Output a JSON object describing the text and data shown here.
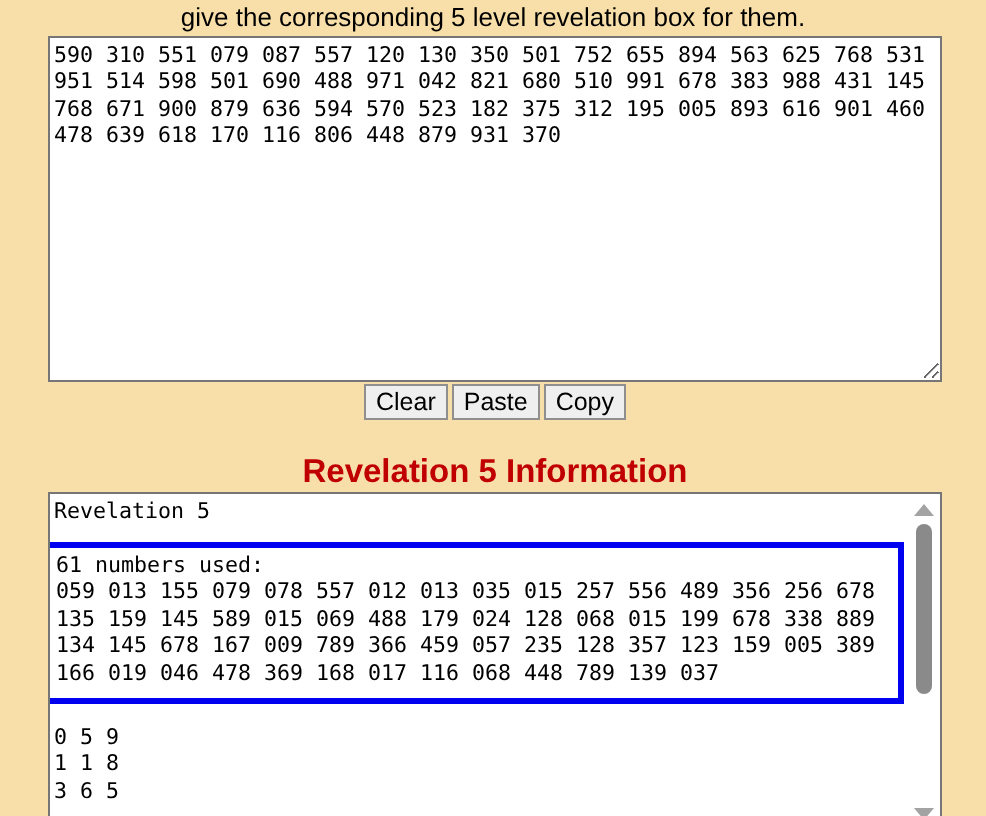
{
  "instructions": "give the corresponding 5 level revelation box for them.",
  "input": {
    "value": "590 310 551 079 087 557 120 130 350 501 752 655 894 563 625 768 531 951 514 598 501 690 488 971 042 821 680 510 991 678 383 988 431 145 768 671 900 879 636 594 570 523 182 375 312 195 005 893 616 901 460 478 639 618 170 116 806 448 879 931 370"
  },
  "buttons": [
    "Clear",
    "Paste",
    "Copy"
  ],
  "heading": "Revelation 5 Information",
  "output": {
    "title_line": "Revelation 5",
    "highlight": {
      "label": "61 numbers used:",
      "lines": [
        "059 013 155 079 078 557 012 013 035 015 257 556 489 356 256 678",
        "135 159 145 589 015 069 488 179 024 128 068 015 199 678 338 889",
        "134 145 678 167 009 789 366 459 057 235 128 357 123 159 005 389",
        "166 019 046 478 369 168 017 116 068 448 789 139 037"
      ]
    },
    "lines": [
      "0 5 9",
      "1 1 8",
      "3 6 5"
    ]
  }
}
